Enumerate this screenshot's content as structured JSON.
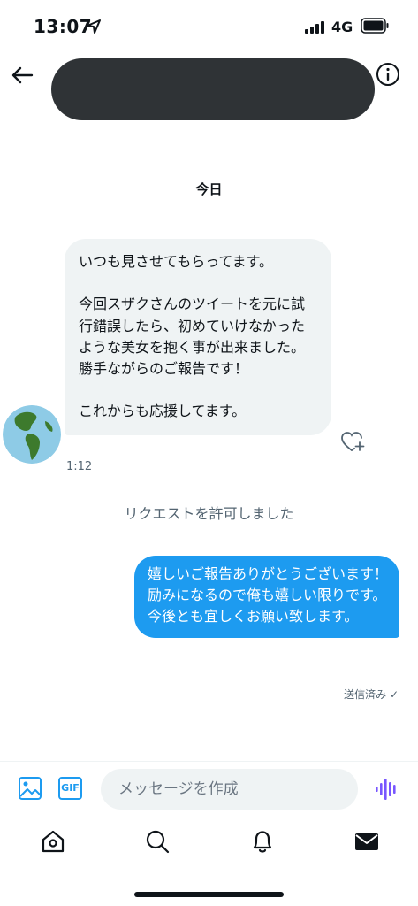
{
  "status_bar": {
    "time": "13:07",
    "network": "4G"
  },
  "conversation": {
    "date_label": "今日",
    "incoming_message": "いつも見させてもらってます。\n\n今回スザクさんのツイートを元に試行錯誤したら、初めていけなかったような美女を抱く事が出来ました。\n勝手ながらのご報告です！\n\nこれからも応援してます。",
    "incoming_time": "1:12",
    "request_notice": "リクエストを許可しました",
    "outgoing_message": "嬉しいご報告ありがとうございます！\n励みになるので俺も嬉しい限りです。\n今後とも宜しくお願い致します。",
    "sent_status": "送信済み ✓"
  },
  "compose": {
    "gif_label": "GIF",
    "placeholder": "メッセージを作成"
  },
  "icons": {
    "back": "arrow-left-icon",
    "info": "info-icon",
    "like": "heart-plus-icon",
    "image": "image-icon",
    "voice": "voice-wave-icon",
    "nav": [
      "home-icon",
      "search-icon",
      "bell-icon",
      "mail-icon"
    ]
  },
  "colors": {
    "accent": "#1d9bf0",
    "incoming_bubble": "#eff3f4",
    "voice": "#7856ff"
  }
}
